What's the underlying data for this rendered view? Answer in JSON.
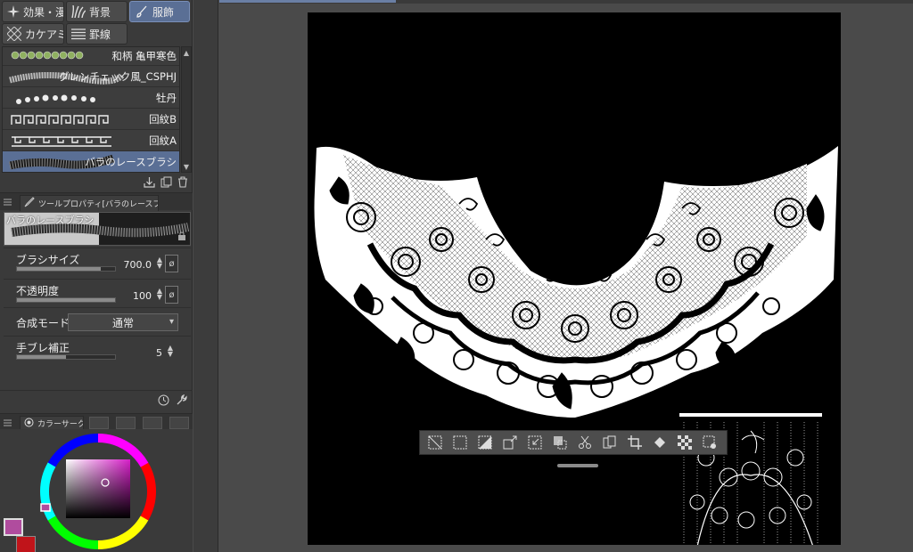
{
  "material_tabs": {
    "row1": [
      {
        "label": "効果・漫",
        "icon": "sparkle-icon",
        "active": false
      },
      {
        "label": "背景",
        "icon": "grass-icon",
        "active": false
      },
      {
        "label": "服飾",
        "icon": "brush-icon",
        "active": true
      }
    ],
    "row2": [
      {
        "label": "カケアミ",
        "icon": "crosshatch-icon",
        "active": false
      },
      {
        "label": "罫線",
        "icon": "lines-icon",
        "active": false
      }
    ]
  },
  "brush_list": {
    "items": [
      {
        "label": "和柄 亀甲寒色"
      },
      {
        "label": "グレンチェック風_CSPHJ"
      },
      {
        "label": "牡丹"
      },
      {
        "label": "回紋B"
      },
      {
        "label": "回紋A"
      },
      {
        "label": "バラのレースブラシ"
      }
    ],
    "selected_index": 5
  },
  "tool_property": {
    "tab_label": "ツールプロパティ[バラのレースブラシ]",
    "preview_label": "バラのレースブラシ",
    "brush_size": {
      "label": "ブラシサイズ",
      "value": "700.0",
      "fill": 0.85
    },
    "opacity": {
      "label": "不透明度",
      "value": "100",
      "fill": 1.0
    },
    "blend_mode": {
      "label": "合成モード",
      "value": "通常"
    },
    "stabilization": {
      "label": "手ブレ補正",
      "value": "5",
      "fill": 0.5
    }
  },
  "color_panel": {
    "tab_label": "カラーサーク",
    "main_color": "#b04c9e",
    "sub_color": "#c0141a"
  },
  "colors": {
    "panel_bg": "#3a3a3a",
    "active_tab": "#5a6f95",
    "canvas_bg": "#000000",
    "workspace_bg": "#4a4a4a"
  },
  "floating_toolbar": {
    "icons": [
      "deselect-icon",
      "select-all-icon",
      "invert-selection-icon",
      "expand-selection-icon",
      "shrink-selection-icon",
      "fill-selection-icon",
      "cut-icon",
      "copy-paste-icon",
      "crop-icon",
      "fill-bucket-icon",
      "transparency-icon",
      "more-settings-icon"
    ]
  }
}
